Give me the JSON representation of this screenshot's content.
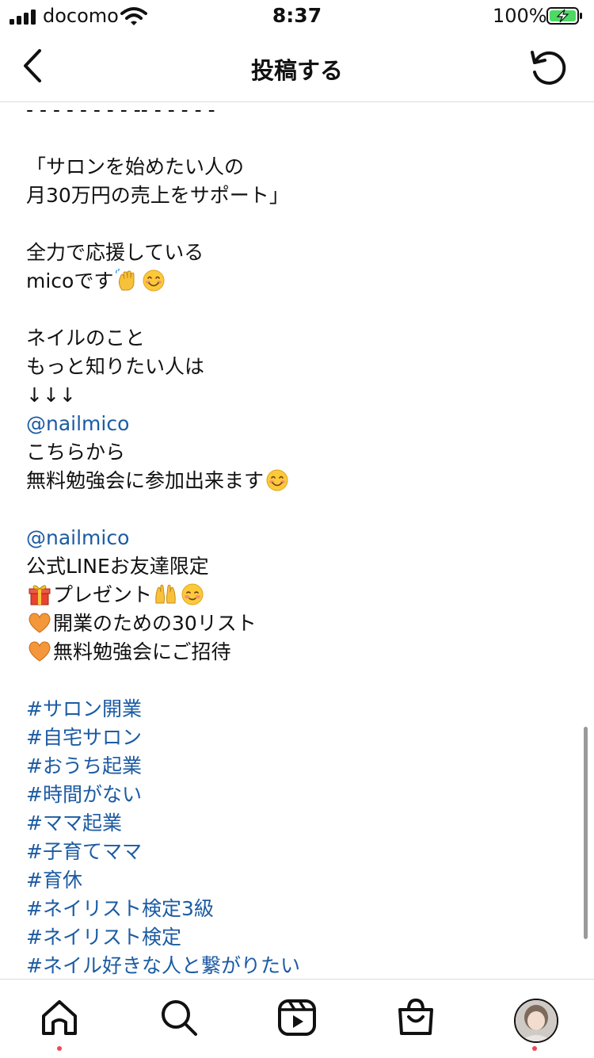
{
  "status_bar": {
    "carrier": "docomo",
    "time": "8:37",
    "battery_percent": "100%"
  },
  "header": {
    "title": "投稿する"
  },
  "caption": {
    "lines": [
      [
        {
          "t": "- - - - - - - - -- - - - - -"
        }
      ],
      [],
      [
        {
          "t": "「サロンを始めたい人の"
        }
      ],
      [
        {
          "t": "月30万円の売上をサポート」"
        }
      ],
      [],
      [
        {
          "t": "全力で応援している"
        }
      ],
      [
        {
          "t": "micoです"
        },
        {
          "emoji": "waving-hand-emoji"
        },
        {
          "emoji": "smiling-face-emoji"
        }
      ],
      [],
      [
        {
          "t": "ネイルのこと"
        }
      ],
      [
        {
          "t": "もっと知りたい人は"
        }
      ],
      [
        {
          "t": "↓↓↓"
        }
      ],
      [
        {
          "t": "@nailmico",
          "link": true
        }
      ],
      [
        {
          "t": "こちらから"
        }
      ],
      [
        {
          "t": "無料勉強会に参加出来ます"
        },
        {
          "emoji": "smiling-face-emoji"
        }
      ],
      [],
      [
        {
          "t": "@nailmico",
          "link": true
        }
      ],
      [
        {
          "t": "公式LINEお友達限定"
        }
      ],
      [
        {
          "emoji": "gift-emoji"
        },
        {
          "t": "プレゼント"
        },
        {
          "emoji": "raised-hands-emoji"
        },
        {
          "emoji": "blushing-face-emoji"
        }
      ],
      [
        {
          "emoji": "orange-heart-emoji"
        },
        {
          "t": "開業のための30リスト"
        }
      ],
      [
        {
          "emoji": "orange-heart-emoji"
        },
        {
          "t": "無料勉強会にご招待"
        }
      ],
      [],
      [
        {
          "t": "#サロン開業",
          "link": true
        }
      ],
      [
        {
          "t": "#自宅サロン",
          "link": true
        }
      ],
      [
        {
          "t": "#おうち起業",
          "link": true
        }
      ],
      [
        {
          "t": "#時間がない",
          "link": true
        }
      ],
      [
        {
          "t": "#ママ起業",
          "link": true
        }
      ],
      [
        {
          "t": "#子育てママ",
          "link": true
        }
      ],
      [
        {
          "t": "#育休",
          "link": true
        }
      ],
      [
        {
          "t": "#ネイリスト検定3級",
          "link": true
        }
      ],
      [
        {
          "t": "#ネイリスト検定",
          "link": true
        }
      ],
      [
        {
          "t": "#ネイル好きな人と繋がりたい",
          "link": true
        }
      ]
    ]
  },
  "tab_bar": {
    "tabs": [
      {
        "name": "home",
        "icon": "home-icon",
        "notification_dot": true
      },
      {
        "name": "search",
        "icon": "search-icon",
        "notification_dot": false
      },
      {
        "name": "reels",
        "icon": "reels-icon",
        "notification_dot": false
      },
      {
        "name": "shop",
        "icon": "shop-bag-icon",
        "notification_dot": false
      },
      {
        "name": "profile",
        "icon": "avatar",
        "notification_dot": true
      }
    ]
  },
  "colors": {
    "link": "#1c5ba3",
    "notification_dot": "#ed4956",
    "battery_fill": "#4cd964"
  }
}
